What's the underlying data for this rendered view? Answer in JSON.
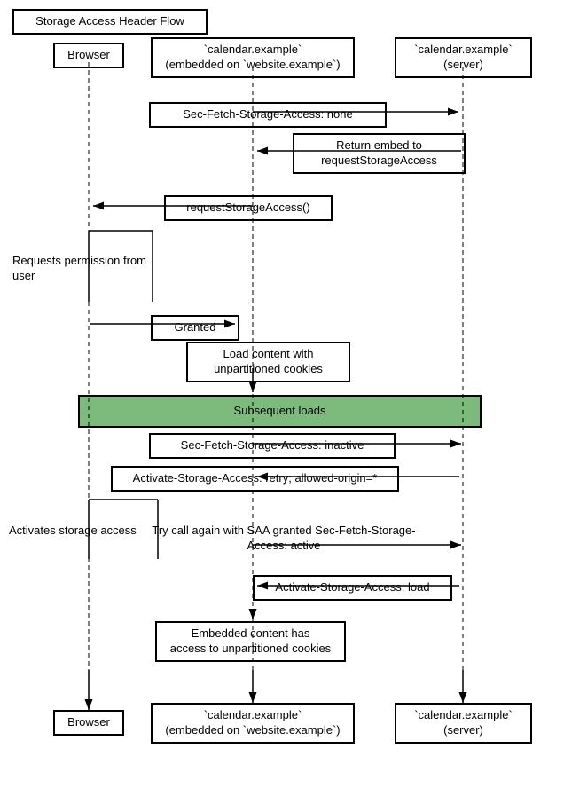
{
  "title": "Storage Access Header Flow",
  "actors": {
    "browser_label": "Browser",
    "embed_label": "`calendar.example`\n(embedded on `website.example`)",
    "server_label": "`calendar.example`\n(server)"
  },
  "boxes": {
    "title": "Storage Access Header Flow",
    "sec_fetch_none": "Sec-Fetch-Storage-Access: none",
    "return_embed": "Return embed to\nrequestStorageAccess",
    "request_storage": "requestStorageAccess()",
    "requests_permission": "Requests permission\nfrom user",
    "granted": "Granted",
    "load_content": "Load content with\nunpartitioned cookies",
    "subsequent_loads": "Subsequent loads",
    "sec_fetch_inactive": "Sec-Fetch-Storage-Access: inactive",
    "activate_retry": "Activate-Storage-Access: retry; allowed-origin=*",
    "activates_storage": "Activates storage access",
    "try_call_again": "Try call again with SAA granted\nSec-Fetch-Storage-Access: active",
    "activate_load": "Activate-Storage-Access: load",
    "embedded_content": "Embedded content has\naccess to unpartitioned cookies",
    "browser_bottom": "Browser",
    "embed_bottom": "`calendar.example`\n(embedded on `website.example`)",
    "server_bottom": "`calendar.example`\n(server)"
  }
}
